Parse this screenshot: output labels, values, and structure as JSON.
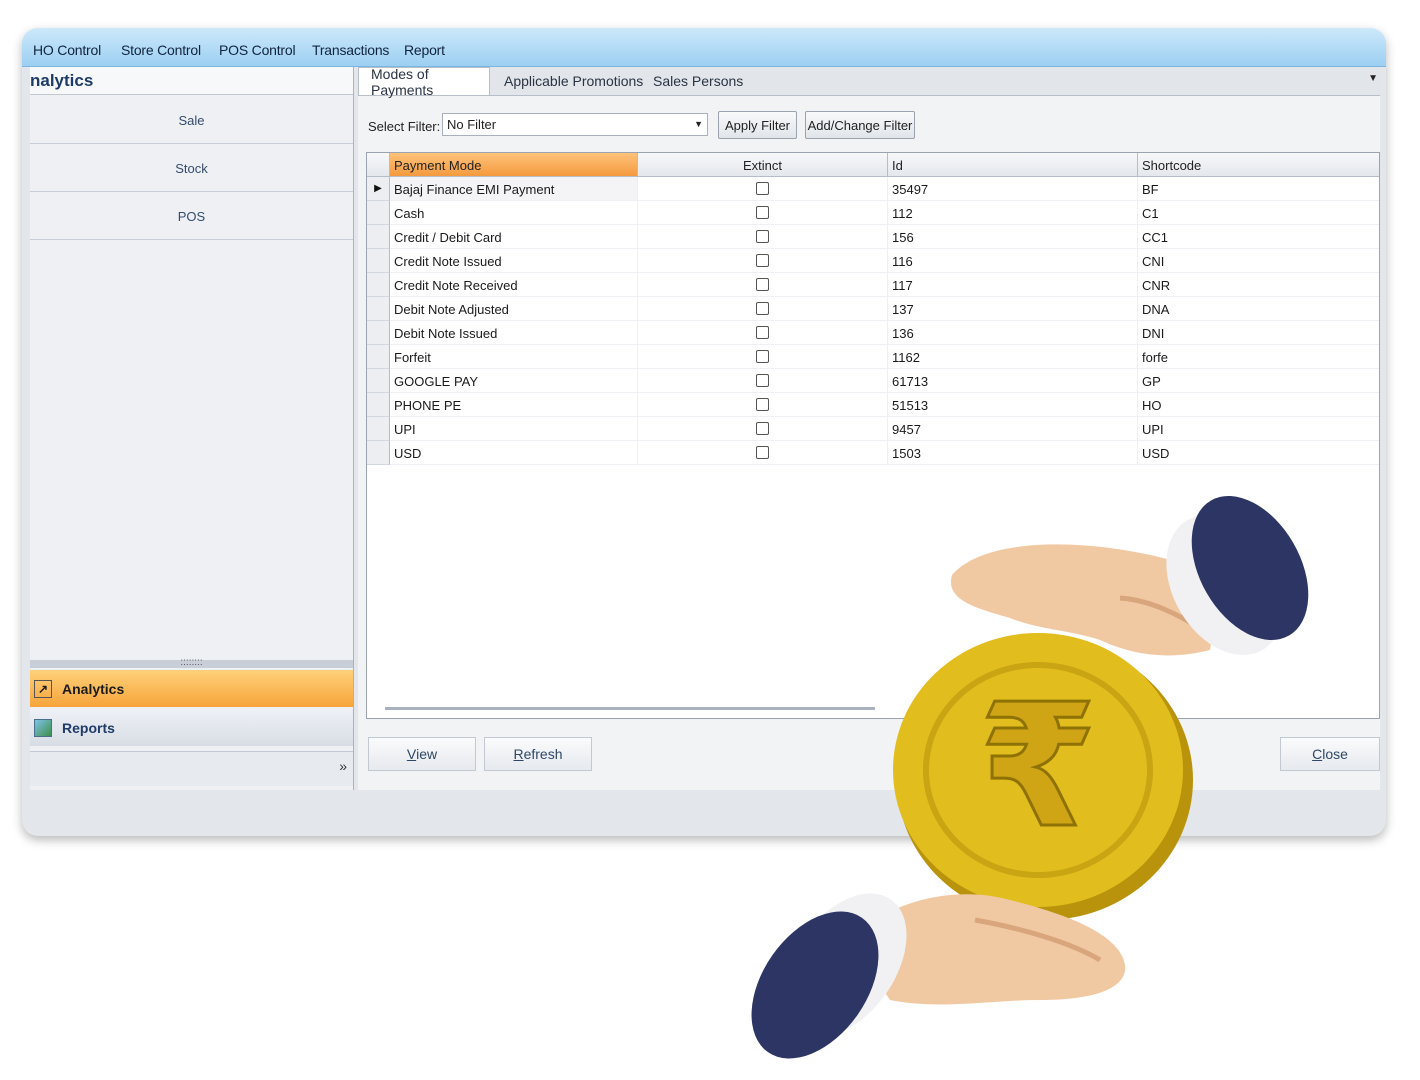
{
  "menu": [
    "HO Control",
    "Store Control",
    "POS Control",
    "Transactions",
    "Report"
  ],
  "left_panel": {
    "title": "nalytics",
    "buttons": [
      "Sale",
      "Stock",
      "POS"
    ],
    "splitter_grip": "::::::::",
    "sections": [
      {
        "label": "Analytics",
        "icon": "arrow-shortcut-icon"
      },
      {
        "label": "Reports",
        "icon": "reports-icon"
      }
    ],
    "overflow": "»"
  },
  "tabs": [
    "Modes of Payments",
    "Applicable Promotions",
    "Sales Persons"
  ],
  "filter": {
    "label": "Select Filter:",
    "value": "No Filter",
    "apply_label": "Apply Filter",
    "change_label": "Add/Change Filter"
  },
  "grid": {
    "columns": [
      "Payment Mode",
      "Extinct",
      "Id",
      "Shortcode"
    ],
    "rows": [
      {
        "mode": "Bajaj Finance EMI Payment",
        "extinct": false,
        "id": "35497",
        "code": "BF"
      },
      {
        "mode": "Cash",
        "extinct": false,
        "id": "112",
        "code": "C1"
      },
      {
        "mode": "Credit / Debit Card",
        "extinct": false,
        "id": "156",
        "code": "CC1"
      },
      {
        "mode": "Credit Note Issued",
        "extinct": false,
        "id": "116",
        "code": "CNI"
      },
      {
        "mode": "Credit Note Received",
        "extinct": false,
        "id": "117",
        "code": "CNR"
      },
      {
        "mode": "Debit Note Adjusted",
        "extinct": false,
        "id": "137",
        "code": "DNA"
      },
      {
        "mode": "Debit Note Issued",
        "extinct": false,
        "id": "136",
        "code": "DNI"
      },
      {
        "mode": "Forfeit",
        "extinct": false,
        "id": "1162",
        "code": "forfe"
      },
      {
        "mode": "GOOGLE PAY",
        "extinct": false,
        "id": "61713",
        "code": "GP"
      },
      {
        "mode": "PHONE PE",
        "extinct": false,
        "id": "51513",
        "code": "HO"
      },
      {
        "mode": "UPI",
        "extinct": false,
        "id": "9457",
        "code": "UPI"
      },
      {
        "mode": "USD",
        "extinct": false,
        "id": "1503",
        "code": "USD"
      }
    ]
  },
  "buttons": {
    "view": {
      "first": "V",
      "rest": "iew"
    },
    "refresh": {
      "first": "R",
      "rest": "efresh"
    },
    "close": {
      "first": "C",
      "rest": "lose"
    }
  },
  "colors": {
    "accent_orange": "#f49a3e",
    "menubar_blue": "#9ccff2",
    "coin_gold": "#e2bd1e",
    "cuff_navy": "#2c3563"
  },
  "illustration": "rupee-coin-hands-icon"
}
